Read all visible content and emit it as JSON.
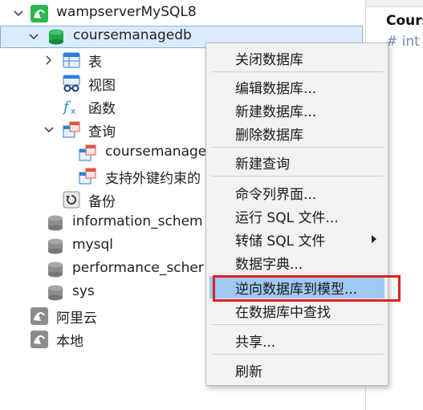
{
  "tree": {
    "connection": {
      "label": "wampserverMySQL8"
    },
    "database": {
      "label": "coursemanagedb"
    },
    "children": {
      "tables": "表",
      "views": "视图",
      "functions": "函数",
      "queries": "查询",
      "query_1": "coursemanage",
      "query_2": "支持外键约束的",
      "backups": "备份"
    },
    "other_databases": [
      "information_schem",
      "mysql",
      "performance_scher",
      "sys"
    ],
    "other_connections": [
      "阿里云",
      "本地"
    ]
  },
  "right_panel": {
    "title": "Cours",
    "subtitle": "# int"
  },
  "context_menu": {
    "items": [
      "关闭数据库",
      "编辑数据库...",
      "新建数据库...",
      "删除数据库",
      "新建查询",
      "命令列界面...",
      "运行 SQL 文件...",
      "转储 SQL 文件",
      "数据字典...",
      "逆向数据库到模型...",
      "在数据库中查找",
      "共享...",
      "刷新"
    ],
    "highlighted": "逆向数据库到模型..."
  },
  "colors": {
    "selection_bg": "#dcebfb",
    "menu_highlight": "#9fc8f3",
    "annotation_red": "#e02020",
    "mysql_green": "#2db84d",
    "db_green": "#1fa84a"
  }
}
